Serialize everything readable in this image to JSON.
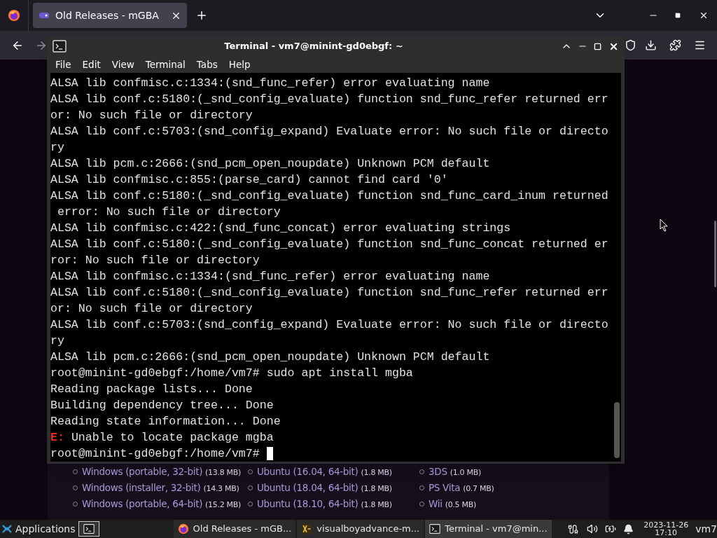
{
  "browser": {
    "tabs": [
      {
        "title": "Old Releases - mGBA",
        "selected": true
      }
    ],
    "downloads": {
      "rows": [
        [
          {
            "label": "Windows (portable, 32-bit)",
            "size": "(13.8 MB)"
          },
          {
            "label": "Ubuntu (16.04, 64-bit)",
            "size": "(1.8 MB)"
          },
          {
            "label": "3DS",
            "size": "(1.0 MB)"
          }
        ],
        [
          {
            "label": "Windows (installer, 32-bit)",
            "size": "(14.3 MB)"
          },
          {
            "label": "Ubuntu (18.04, 64-bit)",
            "size": "(1.8 MB)"
          },
          {
            "label": "PS Vita",
            "size": "(0.7 MB)"
          }
        ],
        [
          {
            "label": "Windows (portable, 64-bit)",
            "size": "(15.2 MB)"
          },
          {
            "label": "Ubuntu (18.10, 64-bit)",
            "size": "(1.8 MB)"
          },
          {
            "label": "Wii",
            "size": "(0.5 MB)"
          }
        ]
      ]
    }
  },
  "terminal": {
    "title": "Terminal - vm7@minint-gd0ebgf: ~",
    "menu": [
      "File",
      "Edit",
      "View",
      "Terminal",
      "Tabs",
      "Help"
    ],
    "lines": [
      {
        "text": "ALSA lib confmisc.c:1334:(snd_func_refer) error evaluating name"
      },
      {
        "text": "ALSA lib conf.c:5180:(_snd_config_evaluate) function snd_func_refer returned err"
      },
      {
        "text": "or: No such file or directory"
      },
      {
        "text": "ALSA lib conf.c:5703:(snd_config_expand) Evaluate error: No such file or directo"
      },
      {
        "text": "ry"
      },
      {
        "text": "ALSA lib pcm.c:2666:(snd_pcm_open_noupdate) Unknown PCM default"
      },
      {
        "text": "ALSA lib confmisc.c:855:(parse_card) cannot find card '0'"
      },
      {
        "text": "ALSA lib conf.c:5180:(_snd_config_evaluate) function snd_func_card_inum returned"
      },
      {
        "text": " error: No such file or directory"
      },
      {
        "text": "ALSA lib confmisc.c:422:(snd_func_concat) error evaluating strings"
      },
      {
        "text": "ALSA lib conf.c:5180:(_snd_config_evaluate) function snd_func_concat returned er"
      },
      {
        "text": "ror: No such file or directory"
      },
      {
        "text": "ALSA lib confmisc.c:1334:(snd_func_refer) error evaluating name"
      },
      {
        "text": "ALSA lib conf.c:5180:(_snd_config_evaluate) function snd_func_refer returned err"
      },
      {
        "text": "or: No such file or directory"
      },
      {
        "text": "ALSA lib conf.c:5703:(snd_config_expand) Evaluate error: No such file or directo"
      },
      {
        "text": "ry"
      },
      {
        "text": "ALSA lib pcm.c:2666:(snd_pcm_open_noupdate) Unknown PCM default"
      },
      {
        "text": "root@minint-gd0ebgf:/home/vm7# sudo apt install mgba"
      },
      {
        "text": "Reading package lists... Done"
      },
      {
        "text": "Building dependency tree... Done"
      },
      {
        "text": "Reading state information... Done"
      },
      {
        "kind": "error",
        "tag": "E:",
        "text": " Unable to locate package mgba"
      },
      {
        "text": "root@minint-gd0ebgf:/home/vm7# "
      }
    ],
    "cursor": true
  },
  "taskbar": {
    "menu_label": "Applications",
    "tasks": [
      {
        "kind": "browser",
        "title": "Old Releases - mGB...",
        "selected": false
      },
      {
        "kind": "editor",
        "title": "visualboyadvance-m...",
        "selected": false
      },
      {
        "kind": "terminal",
        "title": "Terminal - vm7@min...",
        "selected": true
      }
    ],
    "date": "2023-11-26",
    "time": "17:10",
    "user": "vm7"
  }
}
